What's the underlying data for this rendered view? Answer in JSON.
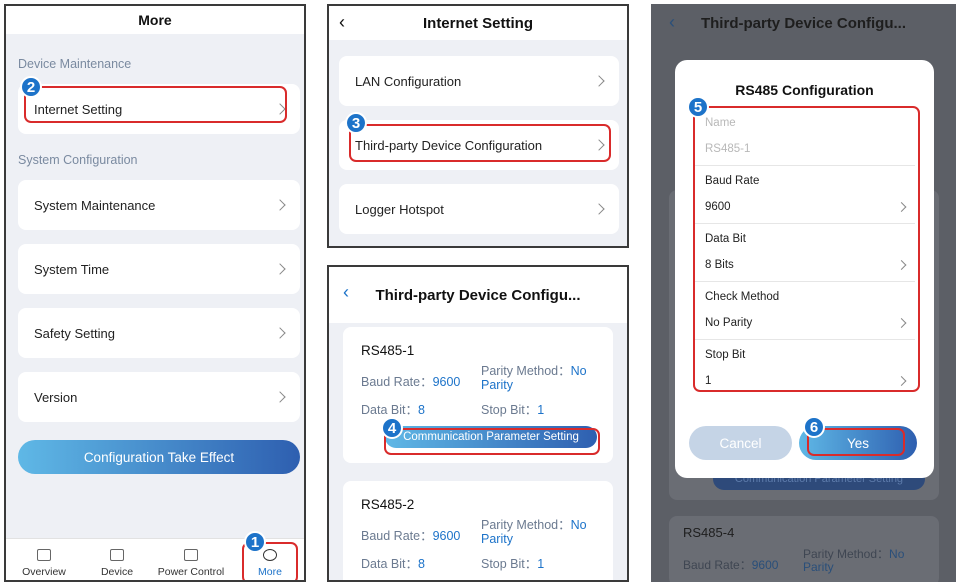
{
  "more": {
    "title": "More",
    "device_maintenance": "Device Maintenance",
    "internet_setting": "Internet Setting",
    "system_configuration": "System Configuration",
    "system_maintenance": "System Maintenance",
    "system_time": "System Time",
    "safety_setting": "Safety Setting",
    "version": "Version",
    "take_effect": "Configuration Take Effect",
    "tabs": [
      "Overview",
      "Device",
      "Power Control",
      "More"
    ]
  },
  "internet": {
    "title": "Internet Setting",
    "items": [
      "LAN Configuration",
      "Third-party Device Configuration",
      "Logger Hotspot"
    ]
  },
  "third": {
    "title": "Third-party Device Configu...",
    "cards": [
      {
        "name": "RS485-1",
        "baud_label": "Baud Rate：",
        "baud": "9600",
        "parity_label": "Parity Method：",
        "parity_no": "No",
        "parity_word": "Parity",
        "data_label": "Data Bit：",
        "data": "8",
        "stop_label": "Stop Bit：",
        "stop": "1",
        "button": "Communication Parameter Setting"
      },
      {
        "name": "RS485-2",
        "baud_label": "Baud Rate：",
        "baud": "9600",
        "parity_label": "Parity Method：",
        "parity_no": "No",
        "parity_word": "Parity",
        "data_label": "Data Bit：",
        "data": "8",
        "stop_label": "Stop Bit：",
        "stop": "1"
      }
    ]
  },
  "rs485": {
    "bg_title": "Third-party Device Configu...",
    "bg_button": "Communication Parameter Setting",
    "bg_card_name": "RS485-4",
    "bg_baud_label": "Baud Rate：",
    "bg_baud": "9600",
    "bg_parity_label": "Parity Method：",
    "bg_parity_no": "No",
    "bg_parity_word": "Parity",
    "dialog_title": "RS485 Configuration",
    "name_label": "Name",
    "name_placeholder": "RS485-1",
    "baud_label": "Baud Rate",
    "baud_value": "9600",
    "data_label": "Data Bit",
    "data_value": "8 Bits",
    "check_label": "Check Method",
    "check_value": "No Parity",
    "stop_label": "Stop Bit",
    "stop_value": "1",
    "cancel": "Cancel",
    "yes": "Yes"
  },
  "steps": [
    "1",
    "2",
    "3",
    "4",
    "5",
    "6"
  ],
  "colors": {
    "accent": "#1d73c9",
    "highlight": "#d92b2b",
    "button_start": "#5fb8e6",
    "button_end": "#2e5fb0"
  }
}
